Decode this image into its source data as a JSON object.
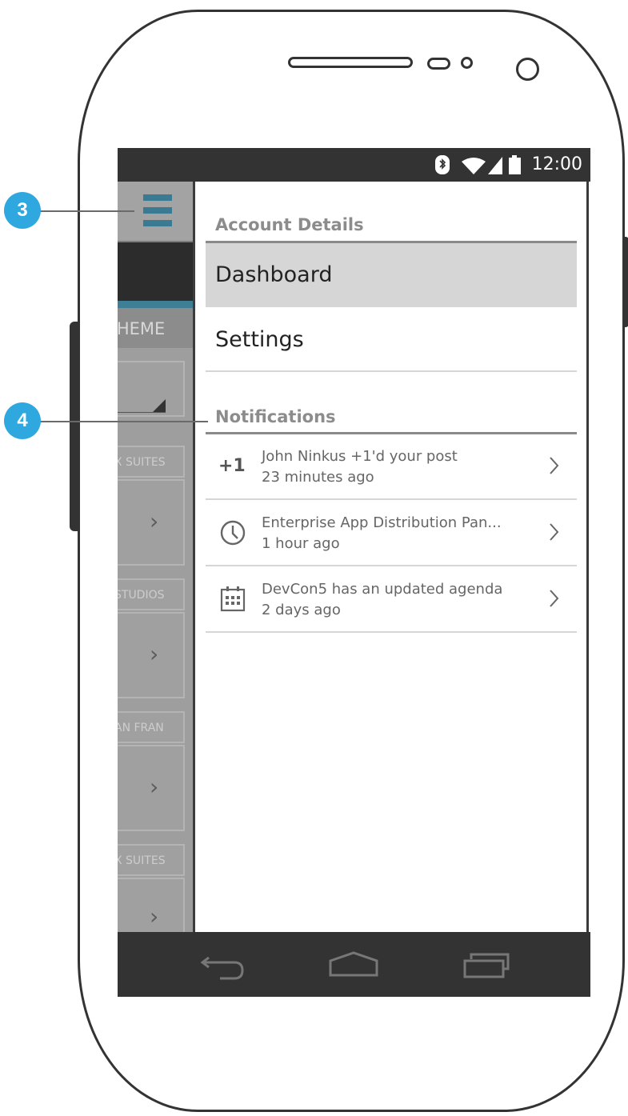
{
  "status_bar": {
    "time": "12:00"
  },
  "left_panel": {
    "theme_label": "THEME",
    "cards": [
      {
        "label": "X SUITES"
      },
      {
        "label": "STUDIOS"
      },
      {
        "label": "AN FRAN"
      },
      {
        "label": "X SUITES"
      }
    ]
  },
  "drawer": {
    "account_header": "Account Details",
    "menu": [
      {
        "label": "Dashboard",
        "active": true
      },
      {
        "label": "Settings",
        "active": false
      }
    ],
    "notifications_header": "Notifications",
    "notifications": [
      {
        "icon": "plus-one-icon",
        "icon_text": "+1",
        "title": "John Ninkus +1'd your post",
        "time": "23 minutes ago"
      },
      {
        "icon": "clock-icon",
        "title": "Enterprise App Distribution Pan...",
        "time": "1 hour ago"
      },
      {
        "icon": "calendar-icon",
        "title": "DevCon5 has an updated agenda",
        "time": "2 days ago"
      }
    ]
  },
  "callouts": [
    {
      "number": "3"
    },
    {
      "number": "4"
    }
  ],
  "colors": {
    "callout": "#2fa8e0",
    "accent": "#3f7f95",
    "frame": "#333333"
  }
}
